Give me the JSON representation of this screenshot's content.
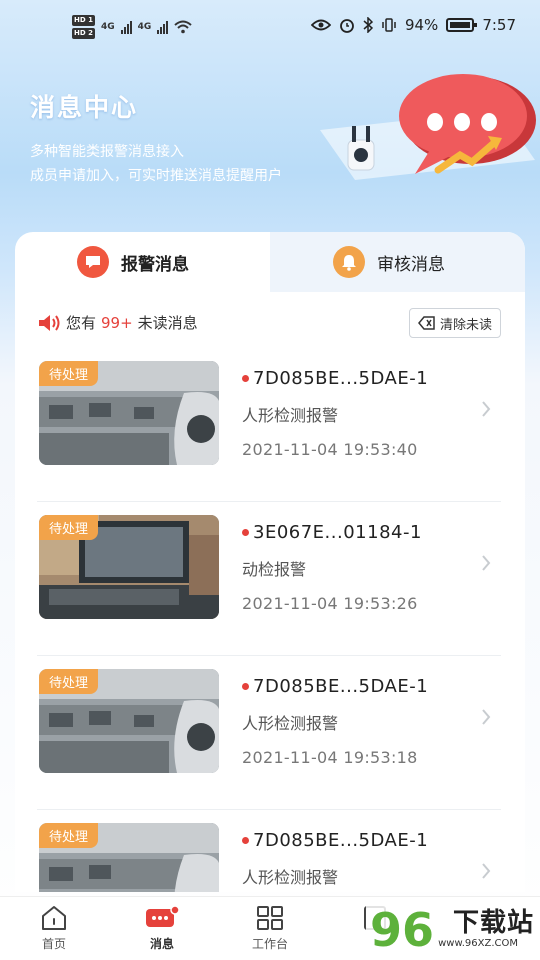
{
  "status_bar": {
    "hd1": "HD 1",
    "hd2": "HD 2",
    "net1": "4G",
    "net2": "4G",
    "battery": "94%",
    "time": "7:57"
  },
  "hero": {
    "title": "消息中心",
    "desc_line1": "多种智能类报警消息接入",
    "desc_line2": "成员申请加入，可实时推送消息提醒用户"
  },
  "tabs": [
    {
      "label": "报警消息",
      "icon": "message-icon",
      "active": true
    },
    {
      "label": "审核消息",
      "icon": "bell-icon",
      "active": false
    }
  ],
  "unread": {
    "prefix": "您有",
    "count": "99+",
    "suffix": "未读消息",
    "clear_label": "清除未读"
  },
  "alerts": [
    {
      "badge": "待处理",
      "device": "7D085BE...5DAE-1",
      "type": "人形检测报警",
      "time": "2021-11-04 19:53:40"
    },
    {
      "badge": "待处理",
      "device": "3E067E...01184-1",
      "type": "动检报警",
      "time": "2021-11-04 19:53:26"
    },
    {
      "badge": "待处理",
      "device": "7D085BE...5DAE-1",
      "type": "人形检测报警",
      "time": "2021-11-04 19:53:18"
    },
    {
      "badge": "待处理",
      "device": "7D085BE...5DAE-1",
      "type": "人形检测报警",
      "time": ""
    }
  ],
  "nav": [
    {
      "label": "首页",
      "icon": "home-icon"
    },
    {
      "label": "消息",
      "icon": "message-icon"
    },
    {
      "label": "工作台",
      "icon": "grid-icon"
    },
    {
      "label": "",
      "icon": "profile-icon"
    }
  ],
  "watermark": {
    "logo": "96",
    "text": "下载站",
    "url": "www.96XZ.COM"
  },
  "colors": {
    "accent_red": "#e5413b",
    "badge_orange": "#f2a34a",
    "tab_red": "#f0573f"
  }
}
